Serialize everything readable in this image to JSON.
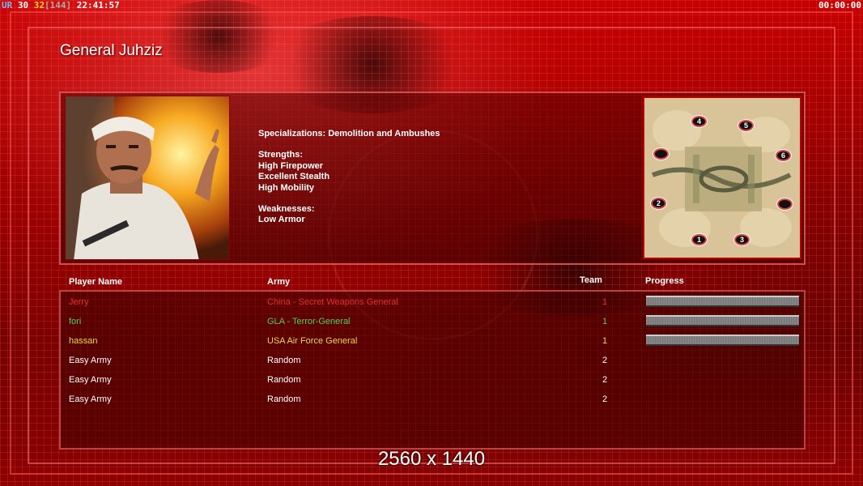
{
  "hud": {
    "prefix": "UR",
    "fps": "30",
    "fps_limit": "32",
    "bracket_value": "[144]",
    "clock": "22:41:57",
    "timer": "00:00:00"
  },
  "general": {
    "title": "General Juhziz",
    "specializations": "Specializations: Demolition and Ambushes",
    "strengths_label": "Strengths:",
    "strengths": [
      "High Firepower",
      "Excellent Stealth",
      "High Mobility"
    ],
    "weaknesses_label": "Weaknesses:",
    "weaknesses": [
      "Low Armor"
    ]
  },
  "minimap": {
    "slots": [
      "4",
      "5",
      "",
      "6",
      "2",
      "",
      "1",
      "3"
    ]
  },
  "table": {
    "headers": {
      "player": "Player Name",
      "army": "Army",
      "team": "Team",
      "progress": "Progress"
    },
    "rows": [
      {
        "name": "Jerry",
        "army": "China - Secret Weapons General",
        "team": "1",
        "color": "#e03030",
        "progress": 1.0
      },
      {
        "name": "fori",
        "army": "GLA - Terror-General",
        "team": "1",
        "color": "#4fd04f",
        "progress": 1.0
      },
      {
        "name": "hassan",
        "army": "USA Air Force General",
        "team": "1",
        "color": "#e8d84a",
        "progress": 1.0
      },
      {
        "name": "Easy Army",
        "army": "Random",
        "team": "2",
        "color": "#ffffff",
        "progress": null
      },
      {
        "name": "Easy Army",
        "army": "Random",
        "team": "2",
        "color": "#ffffff",
        "progress": null
      },
      {
        "name": "Easy Army",
        "army": "Random",
        "team": "2",
        "color": "#ffffff",
        "progress": null
      }
    ]
  },
  "overlay": {
    "resolution": "2560 x 1440"
  }
}
